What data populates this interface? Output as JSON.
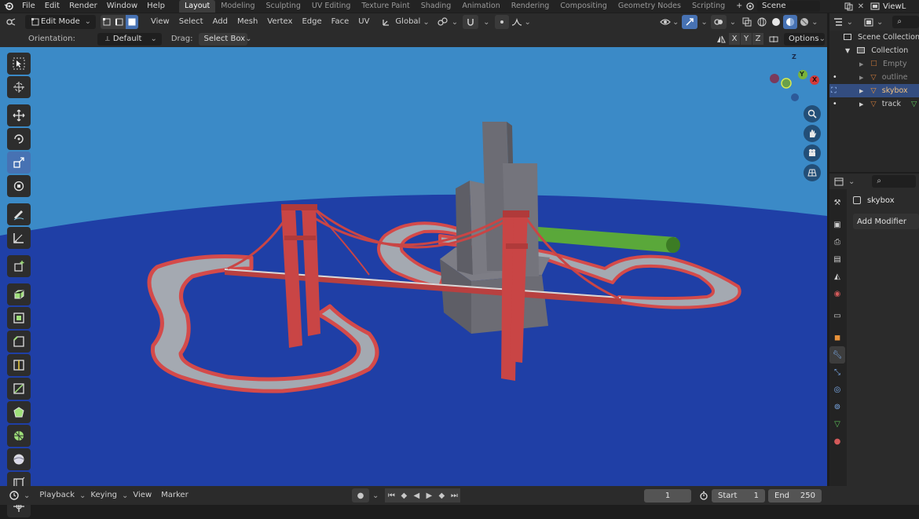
{
  "top_menu": {
    "items": [
      "File",
      "Edit",
      "Render",
      "Window",
      "Help"
    ],
    "workspaces": [
      "Layout",
      "Modeling",
      "Sculpting",
      "UV Editing",
      "Texture Paint",
      "Shading",
      "Animation",
      "Rendering",
      "Compositing",
      "Geometry Nodes",
      "Scripting"
    ],
    "active_workspace": "Layout",
    "add_tab": "+",
    "scene_name": "Scene",
    "view_layer": "ViewL"
  },
  "viewport_header": {
    "mode": "Edit Mode",
    "menus": [
      "View",
      "Select",
      "Add",
      "Mesh",
      "Vertex",
      "Edge",
      "Face",
      "UV"
    ],
    "transform_orientation": "Global"
  },
  "tool_header": {
    "orientation_label": "Orientation:",
    "orientation_value": "Default",
    "drag_label": "Drag:",
    "drag_value": "Select Box",
    "axes": [
      "X",
      "Y",
      "Z"
    ],
    "options": "Options"
  },
  "gizmo": {
    "z": "Z",
    "y": "Y",
    "x": "X"
  },
  "outliner": {
    "root": "Scene Collection",
    "collection": "Collection",
    "items": [
      {
        "name": "Empty",
        "dimmed": true
      },
      {
        "name": "outline",
        "dimmed": true
      },
      {
        "name": "skybox",
        "dimmed": false,
        "selected": true
      },
      {
        "name": "track",
        "dimmed": false
      }
    ]
  },
  "properties": {
    "object_name": "skybox",
    "add_modifier": "Add Modifier"
  },
  "timeline": {
    "menus": [
      "Playback",
      "Keying",
      "View",
      "Marker"
    ],
    "current_frame": "1",
    "start_label": "Start",
    "start": "1",
    "end_label": "End",
    "end": "250"
  },
  "colors": {
    "sky": "#3b8ac7",
    "ground": "#1f3fa6",
    "track": "#a4a9b1",
    "track_edge": "#d44a4a",
    "bridge": "#c94545",
    "building": "#6e6e76",
    "tube": "#5aa83a",
    "accent": "#4772b3"
  }
}
